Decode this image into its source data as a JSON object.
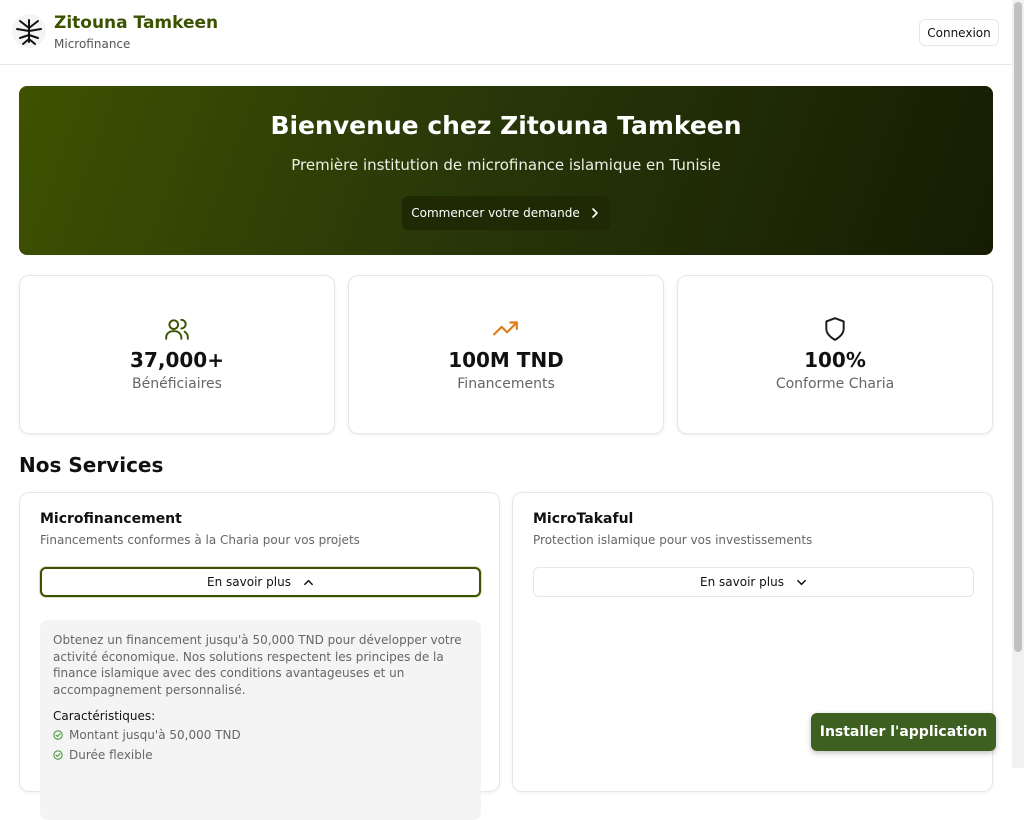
{
  "header": {
    "brand_name": "Zitouna Tamkeen",
    "brand_sub": "Microfinance",
    "login_label": "Connexion",
    "logo_icon": "tree-logo-icon"
  },
  "hero": {
    "title": "Bienvenue chez Zitouna Tamkeen",
    "subtitle": "Première institution de microfinance islamique en Tunisie",
    "cta_label": "Commencer votre demande",
    "cta_icon": "chevron-right-icon"
  },
  "stats": [
    {
      "icon": "users-icon",
      "value": "37,000+",
      "label": "Bénéficiaires",
      "color": "#3d5200"
    },
    {
      "icon": "trending-up-icon",
      "value": "100M TND",
      "label": "Financements",
      "color": "#e07b1a"
    },
    {
      "icon": "shield-icon",
      "value": "100%",
      "label": "Conforme Charia",
      "color": "#1a1a1a"
    }
  ],
  "services": {
    "title": "Nos Services",
    "items": [
      {
        "title": "Microfinancement",
        "description": "Financements conformes à la Charia pour vos projets",
        "more_label": "En savoir plus",
        "expanded": true,
        "details": "Obtenez un financement jusqu'à 50,000 TND pour développer votre activité économique. Nos solutions respectent les principes de la finance islamique avec des conditions avantageuses et un accompagnement personnalisé.",
        "features_title": "Caractéristiques:",
        "features": [
          "Montant jusqu'à 50,000 TND",
          "Durée flexible"
        ]
      },
      {
        "title": "MicroTakaful",
        "description": "Protection islamique pour vos investissements",
        "more_label": "En savoir plus",
        "expanded": false
      }
    ]
  },
  "install_label": "Installer l'application",
  "colors": {
    "brand": "#3d5200",
    "install": "#3d5f1f",
    "accent_orange": "#e07b1a",
    "check": "#4a9a3a"
  }
}
